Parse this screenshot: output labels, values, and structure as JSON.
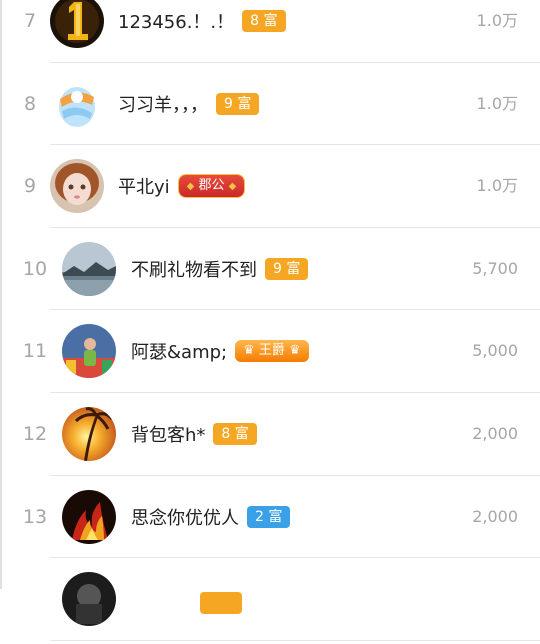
{
  "colors": {
    "badge_gold": "#f5a623",
    "badge_blue": "#3aa0e8",
    "rank_text": "#a6a6a6"
  },
  "rows": [
    {
      "rank": "7",
      "name": "123456.！.！",
      "badge": "8 富",
      "value": "1.0万"
    },
    {
      "rank": "8",
      "name": "习习羊，，，",
      "badge": "9 富",
      "value": "1.0万"
    },
    {
      "rank": "9",
      "name": "平北yi",
      "badge": "郡公",
      "value": "1.0万"
    },
    {
      "rank": "10",
      "name": "不刷礼物看不到",
      "badge": "9 富",
      "value": "5,700"
    },
    {
      "rank": "11",
      "name": "阿瑟&amp;",
      "badge": "王爵",
      "value": "5,000"
    },
    {
      "rank": "12",
      "name": "背包客h*",
      "badge": "8 富",
      "value": "2,000"
    },
    {
      "rank": "13",
      "name": "思念你优优人",
      "badge": "2 富",
      "value": "2,000"
    }
  ]
}
